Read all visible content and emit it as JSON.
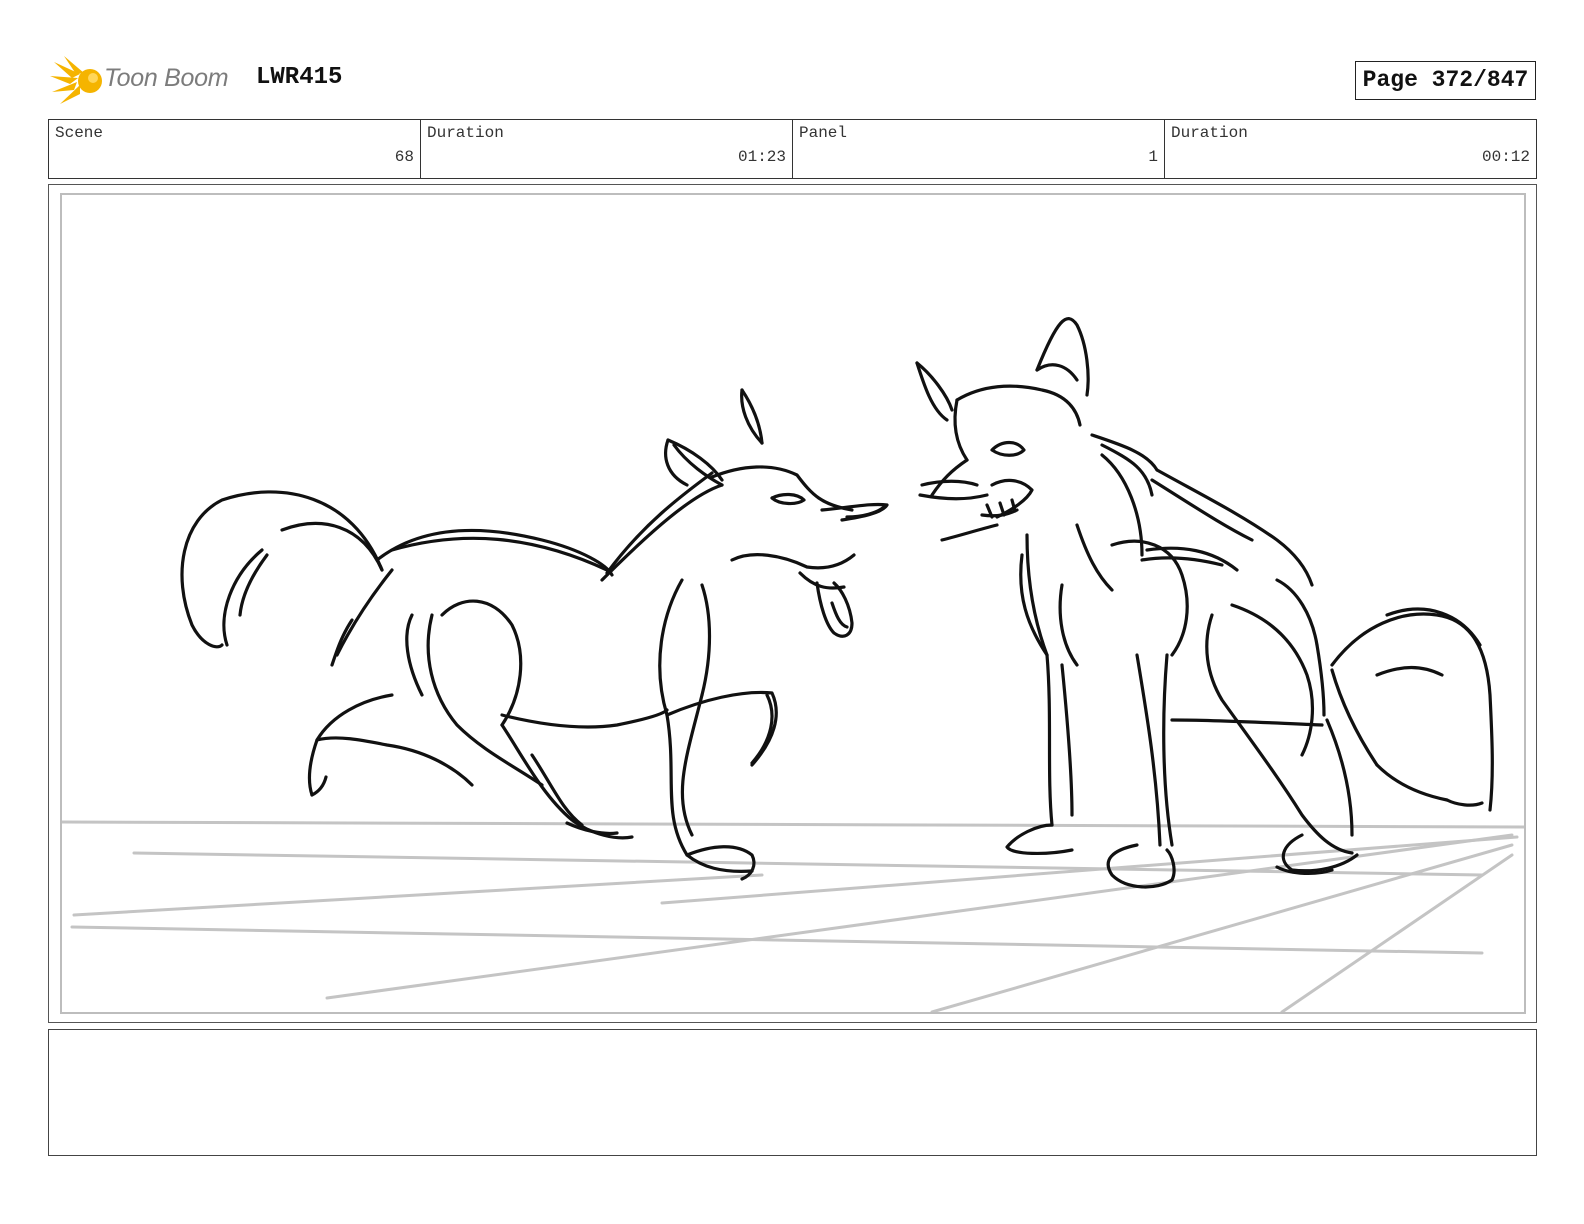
{
  "header": {
    "brand_name": "Toon Boom",
    "project_code": "LWR415",
    "page_label": "Page 372/847"
  },
  "info": [
    {
      "label": "Scene",
      "value": "68"
    },
    {
      "label": "Duration",
      "value": "01:23"
    },
    {
      "label": "Panel",
      "value": "1"
    },
    {
      "label": "Duration",
      "value": "00:12"
    }
  ],
  "panel": {
    "content": "sketch",
    "line_color": "#111111",
    "floor_line_color": "#c4c4c4"
  },
  "notes": {
    "text": ""
  },
  "colors": {
    "logo_accent": "#f5b400",
    "border": "#333333"
  },
  "icons": [
    "toon-boom-logo-icon"
  ]
}
